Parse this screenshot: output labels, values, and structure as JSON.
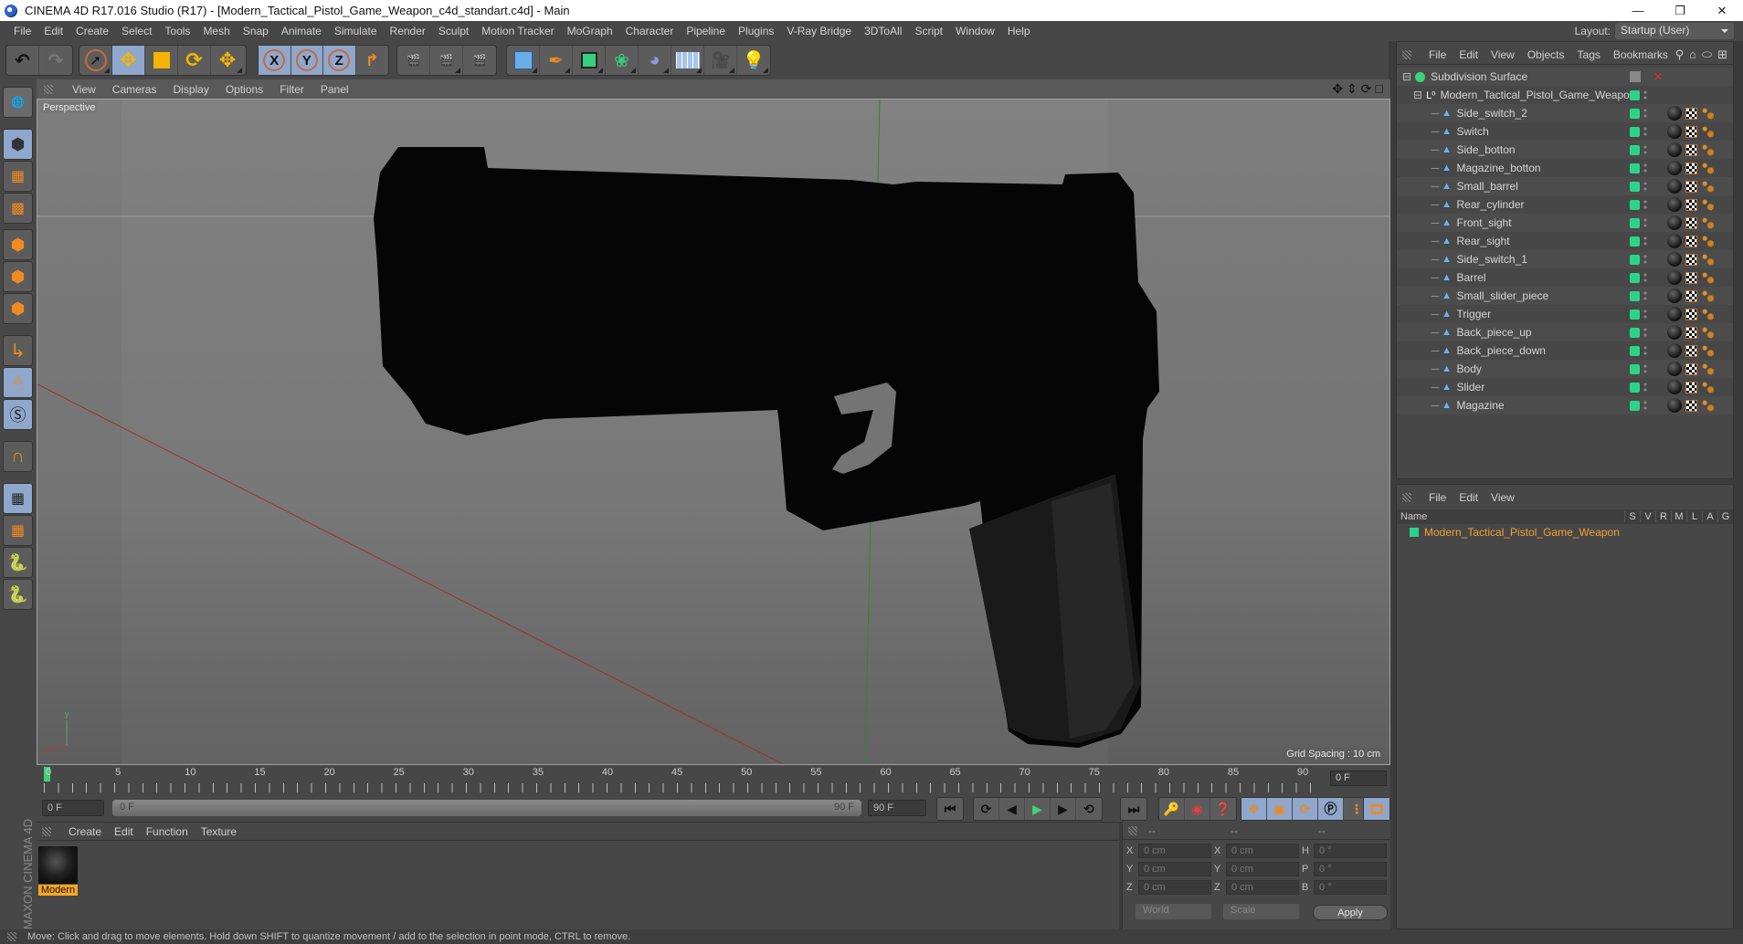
{
  "window": {
    "title": "CINEMA 4D R17.016 Studio (R17) - [Modern_Tactical_Pistol_Game_Weapon_c4d_standart.c4d] - Main",
    "controls": [
      "minimize-icon",
      "restore-icon",
      "close-icon"
    ]
  },
  "menubar": {
    "items": [
      "File",
      "Edit",
      "Create",
      "Select",
      "Tools",
      "Mesh",
      "Snap",
      "Animate",
      "Simulate",
      "Render",
      "Sculpt",
      "Motion Tracker",
      "MoGraph",
      "Character",
      "Pipeline",
      "Plugins",
      "V-Ray Bridge",
      "3DToAll",
      "Script",
      "Window",
      "Help"
    ],
    "layout_label": "Layout:",
    "layout_value": "Startup (User)"
  },
  "toolbar": {
    "undo": "undo-icon",
    "redo": "redo-icon",
    "tools": [
      "select-arrow-icon",
      "move-icon",
      "scale-icon",
      "rotate-icon",
      "move-live-icon"
    ],
    "axes": [
      "X",
      "Y",
      "Z"
    ],
    "coord_system": "world-coord-icon",
    "render": [
      "render-view-icon",
      "render-picture-viewer-icon",
      "render-settings-icon"
    ],
    "create": [
      "cube-icon",
      "pen-spline-icon",
      "subdivision-icon",
      "cloner-icon",
      "deformer-icon",
      "floor-icon",
      "camera-icon",
      "light-icon"
    ]
  },
  "left_tools": [
    "model-mode-icon",
    "object-mode-icon",
    "texture-mode-icon",
    "workplane-icon",
    "points-mode-icon",
    "edges-mode-icon",
    "polygons-mode-icon",
    "axis-mode-icon",
    "tweak-mode-icon",
    "solo-icon",
    "magnet-icon",
    "lock-workplane-icon",
    "snap-workplane-icon",
    "python-icon",
    "python-icon-2"
  ],
  "viewport": {
    "menu": [
      "View",
      "Cameras",
      "Display",
      "Options",
      "Filter",
      "Panel"
    ],
    "label": "Perspective",
    "grid_spacing": "Grid Spacing : 10 cm",
    "nav_icons": [
      "pan-icon",
      "zoom-icon",
      "orbit-icon",
      "maximize-icon"
    ]
  },
  "timeline": {
    "ticks": [
      "0",
      "5",
      "10",
      "15",
      "20",
      "25",
      "30",
      "35",
      "40",
      "45",
      "50",
      "55",
      "60",
      "65",
      "70",
      "75",
      "80",
      "85",
      "90"
    ],
    "current_frame": "0 F",
    "start_field": "0 F",
    "range_start": "0 F",
    "range_end": "90 F",
    "end_field": "90 F",
    "playhead_frame": 0
  },
  "transport": {
    "play_buttons": [
      "go-start-icon",
      "prev-key-icon",
      "prev-frame-icon",
      "play-icon",
      "next-frame-icon",
      "next-key-icon",
      "go-end-icon"
    ],
    "key_buttons": [
      "keyframe-disabled-icon",
      "autokey-icon",
      "keyframe-help-icon"
    ],
    "track_buttons": [
      "track-position-icon",
      "track-scale-icon",
      "track-rotation-icon",
      "track-param-icon",
      "track-pla-icon"
    ],
    "timeline_btn": "timeline-window-icon"
  },
  "materials": {
    "menu": [
      "Create",
      "Edit",
      "Function",
      "Texture"
    ],
    "items": [
      {
        "name": "Modern"
      }
    ]
  },
  "brand": "MAXON CINEMA 4D",
  "coordinates": {
    "headers": [
      "--",
      "--",
      "--"
    ],
    "rows": [
      {
        "a": "X",
        "av": "0 cm",
        "b": "X",
        "bv": "0 cm",
        "c": "H",
        "cv": "0 °"
      },
      {
        "a": "Y",
        "av": "0 cm",
        "b": "Y",
        "bv": "0 cm",
        "c": "P",
        "cv": "0 °"
      },
      {
        "a": "Z",
        "av": "0 cm",
        "b": "Z",
        "bv": "0 cm",
        "c": "B",
        "cv": "0 °"
      }
    ],
    "space": "World",
    "mode": "Scale",
    "apply": "Apply"
  },
  "status": "Move: Click and drag to move elements. Hold down SHIFT to quantize movement / add to the selection in point mode, CTRL to remove.",
  "objects": {
    "menu": [
      "File",
      "Edit",
      "View",
      "Objects",
      "Tags",
      "Bookmarks"
    ],
    "root": "Subdivision Surface",
    "group": "Modern_Tactical_Pistol_Game_Weapon",
    "children": [
      "Side_switch_2",
      "Switch",
      "Side_botton",
      "Magazine_botton",
      "Small_barrel",
      "Rear_cylinder",
      "Front_sight",
      "Rear_sight",
      "Side_switch_1",
      "Barrel",
      "Small_slider_piece",
      "Trigger",
      "Back_piece_up",
      "Back_piece_down",
      "Body",
      "Slider",
      "Magazine"
    ]
  },
  "attributes": {
    "menu": [
      "File",
      "Edit",
      "View"
    ],
    "name_col": "Name",
    "cols": [
      "S",
      "V",
      "R",
      "M",
      "L",
      "A",
      "G"
    ],
    "layer": "Modern_Tactical_Pistol_Game_Weapon"
  },
  "colors": {
    "accent_blue": "#8fa7cc",
    "visible_green": "#2bd38b",
    "material_orange": "#f7a823",
    "layer_orange": "#f0a030"
  }
}
